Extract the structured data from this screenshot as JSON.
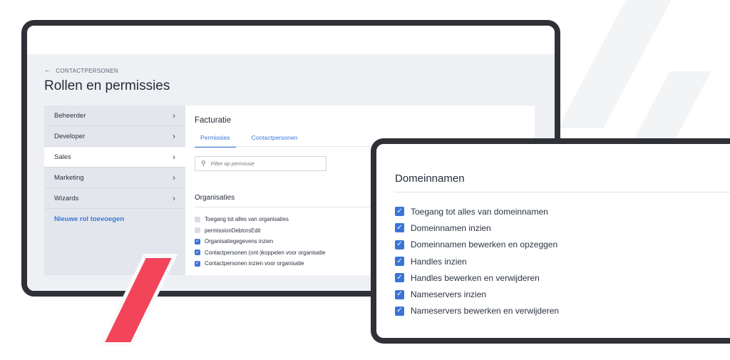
{
  "icons": {
    "back": "arrow-left-icon",
    "chevron": "chevron-right-icon",
    "search": "search-icon",
    "check": "checkmark-icon"
  },
  "colors": {
    "accent": "#3a74d6",
    "frame": "#2f3137",
    "decor_red": "#f2455a",
    "sidebar_bg": "#e3e6ec"
  },
  "header": {
    "back_label": "CONTACTPERSONEN",
    "title": "Rollen en permissies"
  },
  "sidebar": {
    "items": [
      {
        "label": "Beheerder",
        "active": false
      },
      {
        "label": "Developer",
        "active": false
      },
      {
        "label": "Sales",
        "active": true
      },
      {
        "label": "Marketing",
        "active": false
      },
      {
        "label": "Wizards",
        "active": false
      }
    ],
    "add_label": "Nieuwe rol toevoegen"
  },
  "panel": {
    "title": "Facturatie",
    "tabs": [
      {
        "label": "Permissies",
        "active": true
      },
      {
        "label": "Contactpersonen",
        "active": false
      }
    ],
    "filter_placeholder": "Filter op permissie",
    "section_title": "Organisaties",
    "permissions": [
      {
        "label": "Toegang tot alles van organisaties",
        "checked": false
      },
      {
        "label": "permissionDebtorsEdit",
        "checked": false
      },
      {
        "label": "Organisatiegegevens inzien",
        "checked": true
      },
      {
        "label": "Contactpersonen (ont-)koppelen voor organisatie",
        "checked": true
      },
      {
        "label": "Contactpersonen inzien voor organisatie",
        "checked": true
      }
    ]
  },
  "card": {
    "title": "Domeinnamen",
    "items": [
      {
        "label": "Toegang tot alles van domeinnamen",
        "checked": true
      },
      {
        "label": "Domeinnamen inzien",
        "checked": true
      },
      {
        "label": "Domeinnamen bewerken en opzeggen",
        "checked": true
      },
      {
        "label": "Handles inzien",
        "checked": true
      },
      {
        "label": "Handles bewerken en verwijderen",
        "checked": true
      },
      {
        "label": "Nameservers inzien",
        "checked": true
      },
      {
        "label": "Nameservers bewerken en verwijderen",
        "checked": true
      }
    ]
  }
}
